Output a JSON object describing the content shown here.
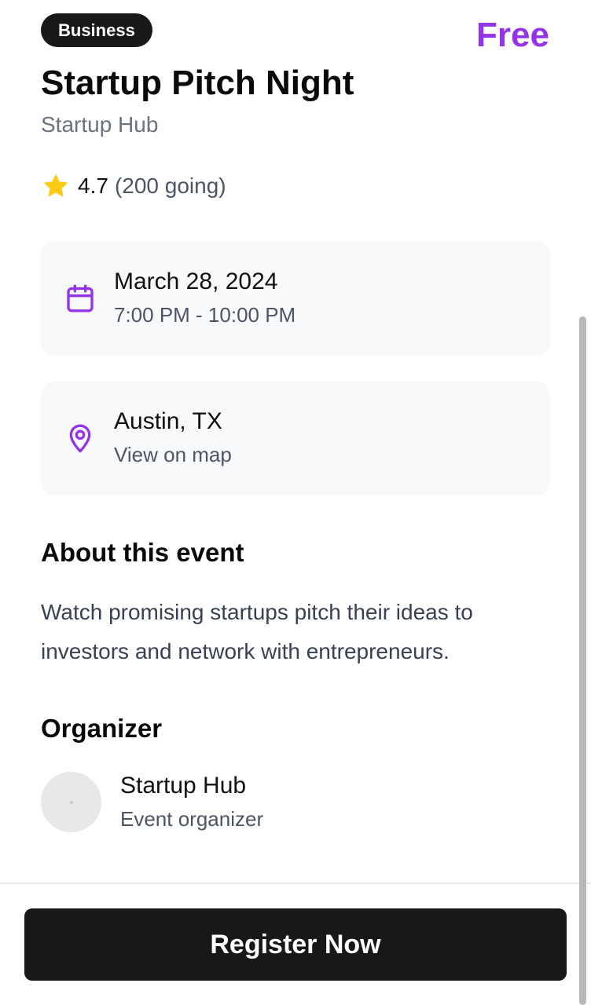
{
  "event": {
    "category": "Business",
    "price": "Free",
    "title": "Startup Pitch Night",
    "host": "Startup Hub",
    "rating": "4.7",
    "going": "(200 going)"
  },
  "date_card": {
    "icon": "calendar-icon",
    "date": "March 28, 2024",
    "time": "7:00 PM - 10:00 PM"
  },
  "location_card": {
    "icon": "map-pin-icon",
    "place": "Austin, TX",
    "link": "View on map"
  },
  "about": {
    "heading": "About this event",
    "text": "Watch promising startups pitch their ideas to investors and network with entrepreneurs."
  },
  "organizer": {
    "heading": "Organizer",
    "name": "Startup Hub",
    "role": "Event organizer"
  },
  "footer": {
    "register_label": "Register Now"
  },
  "colors": {
    "accent": "#9333ea",
    "star": "#facc15",
    "button": "#18181b",
    "card_bg": "#f8f9fb"
  }
}
